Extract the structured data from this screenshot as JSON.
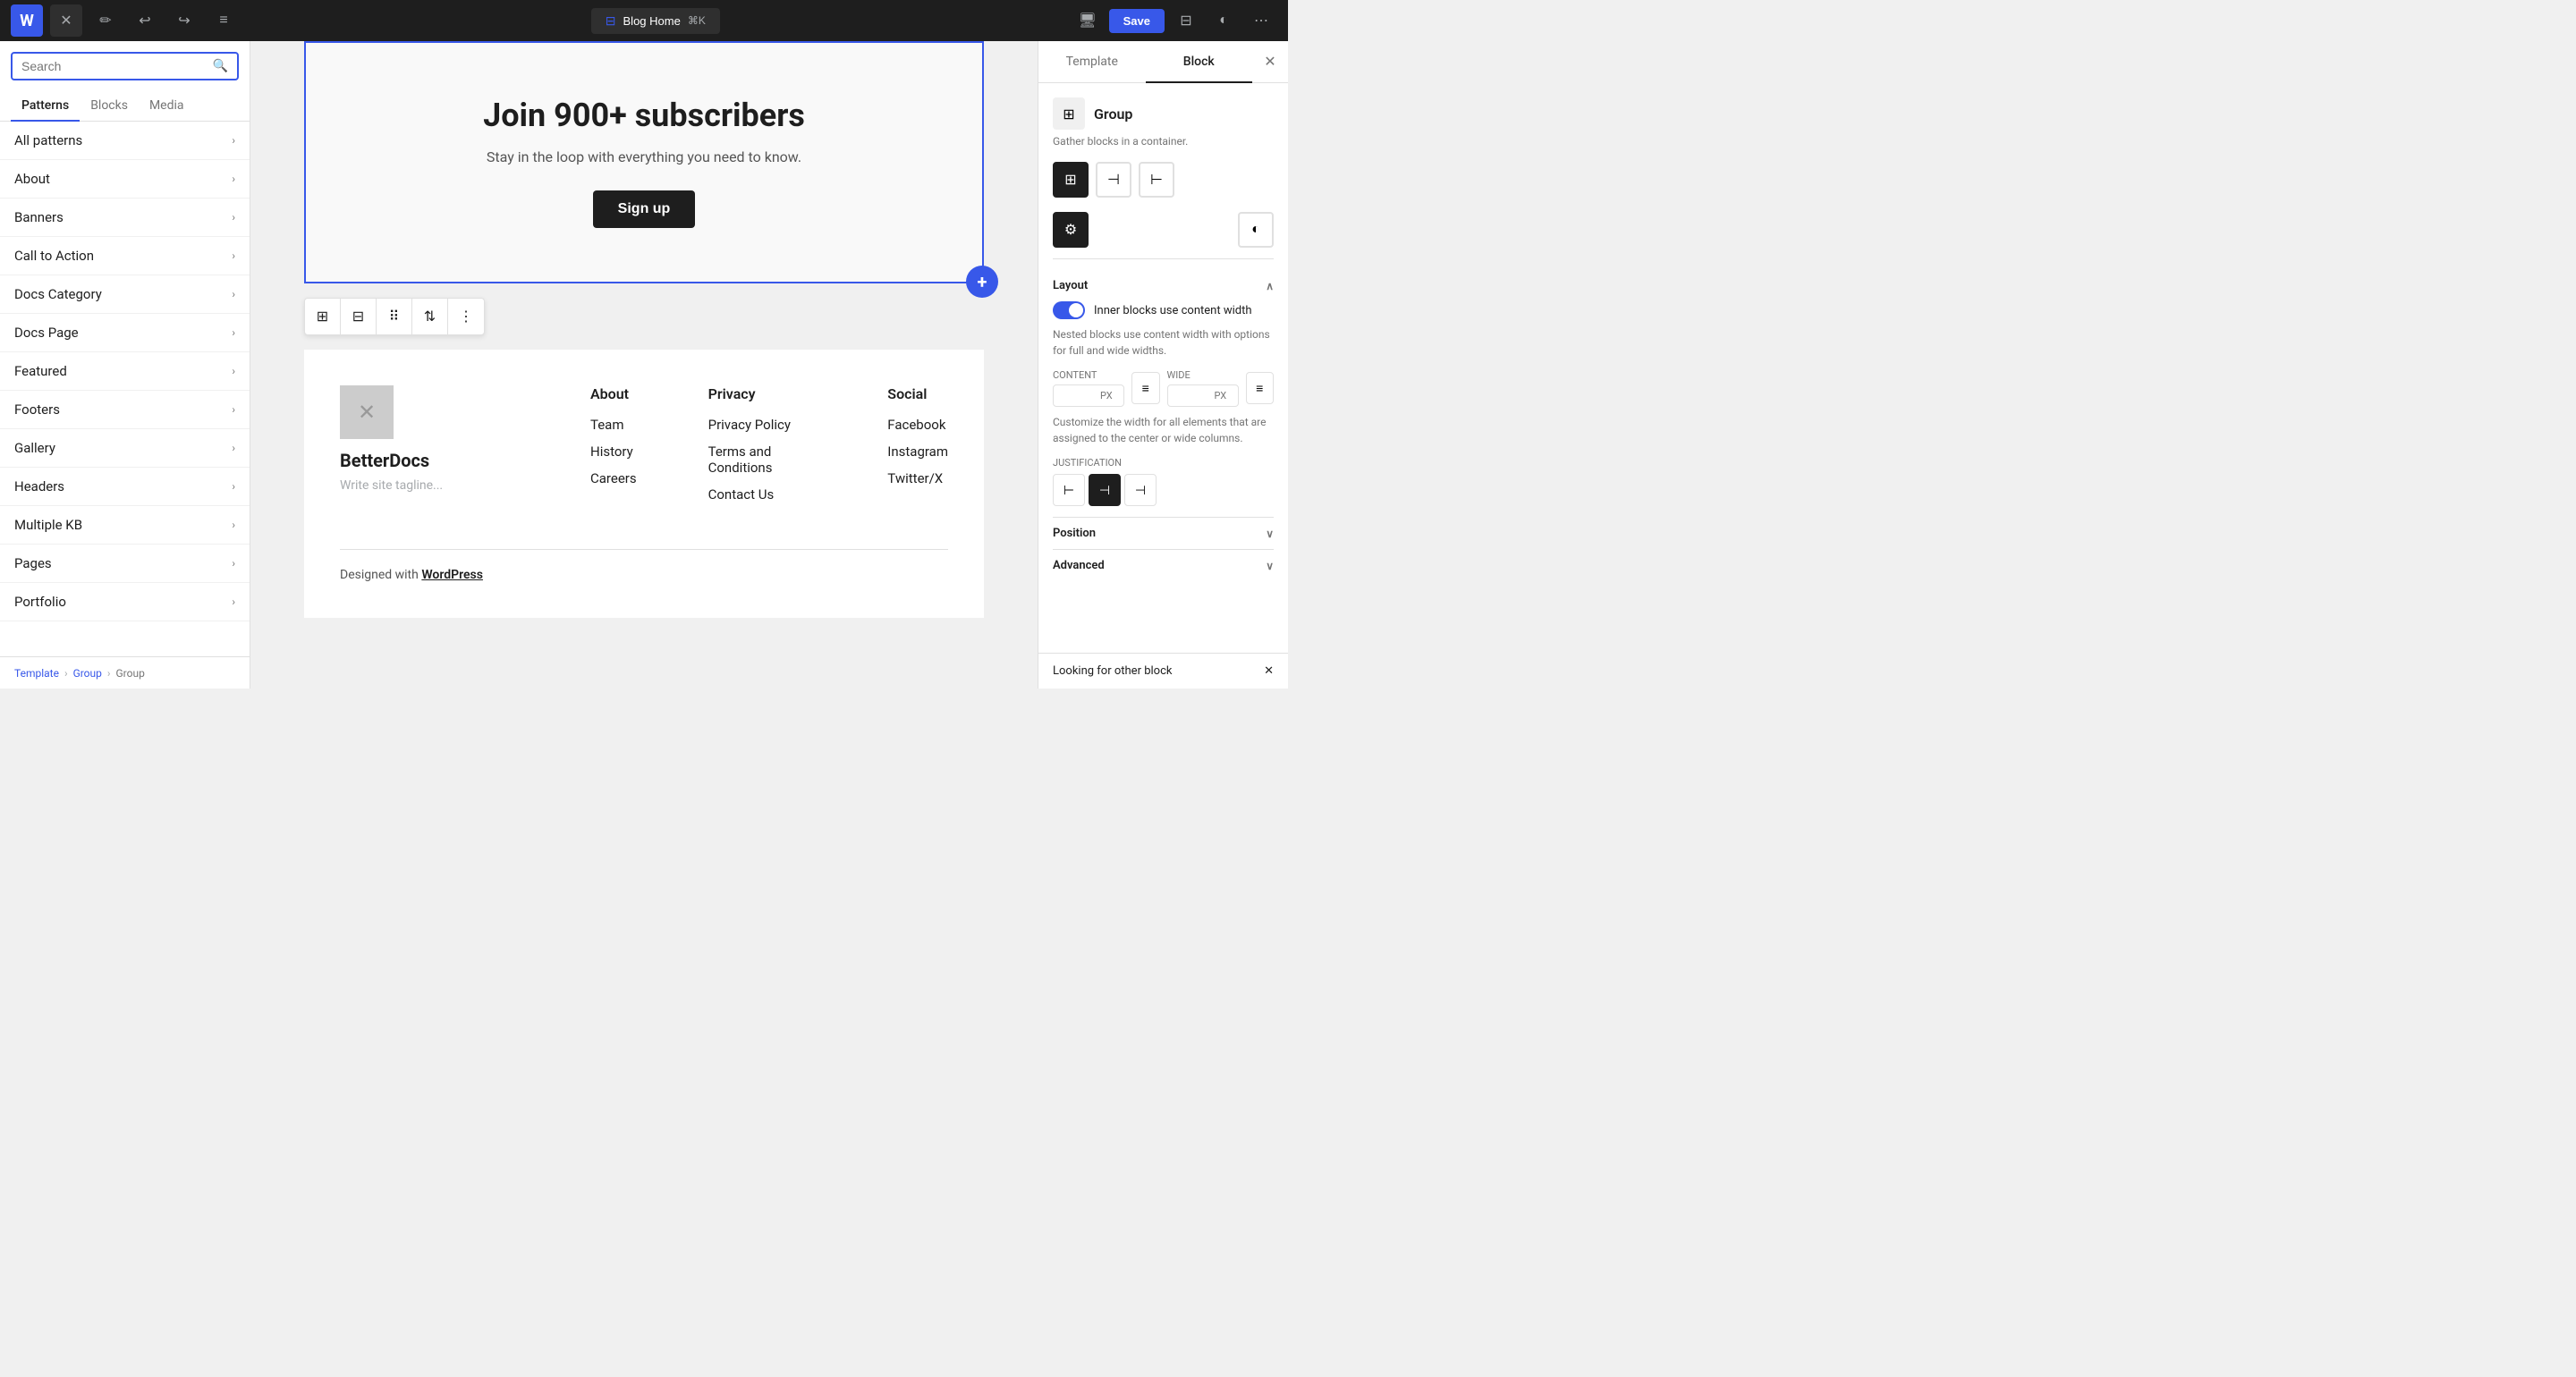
{
  "toolbar": {
    "wp_logo": "W",
    "close_label": "✕",
    "pencil_label": "✏",
    "undo_label": "↩",
    "redo_label": "↪",
    "list_label": "≡",
    "blog_home": "Blog Home",
    "cmd_k": "⌘K",
    "save_label": "Save",
    "desktop_icon": "🖥",
    "sidebar_icon": "⊟",
    "contrast_icon": "◐",
    "more_icon": "⋯"
  },
  "left_sidebar": {
    "search_placeholder": "Search",
    "tabs": [
      "Patterns",
      "Blocks",
      "Media"
    ],
    "active_tab": "Patterns",
    "items": [
      {
        "label": "All patterns"
      },
      {
        "label": "About"
      },
      {
        "label": "Banners"
      },
      {
        "label": "Call to Action"
      },
      {
        "label": "Docs Category"
      },
      {
        "label": "Docs Page"
      },
      {
        "label": "Featured"
      },
      {
        "label": "Footers"
      },
      {
        "label": "Gallery"
      },
      {
        "label": "Headers"
      },
      {
        "label": "Multiple KB"
      },
      {
        "label": "Pages"
      },
      {
        "label": "Portfolio"
      }
    ]
  },
  "breadcrumb": {
    "template": "Template",
    "sep1": "›",
    "group1": "Group",
    "sep2": "›",
    "group2": "Group"
  },
  "canvas": {
    "newsletter": {
      "title": "Join 900+ subscribers",
      "subtitle": "Stay in the loop with everything you need to know.",
      "button_label": "Sign up"
    },
    "footer": {
      "brand_name": "BetterDocs",
      "tagline_placeholder": "Write site tagline...",
      "nav_cols": [
        {
          "heading": "About",
          "links": [
            "Team",
            "History",
            "Careers"
          ]
        },
        {
          "heading": "Privacy",
          "links": [
            "Privacy Policy",
            "Terms and Conditions",
            "Contact Us"
          ]
        },
        {
          "heading": "Social",
          "links": [
            "Facebook",
            "Instagram",
            "Twitter/X"
          ]
        }
      ],
      "footer_text": "Designed with ",
      "footer_link": "WordPress"
    }
  },
  "right_sidebar": {
    "tabs": [
      "Template",
      "Block"
    ],
    "active_tab": "Block",
    "close_icon": "✕",
    "block": {
      "icon": "⊞",
      "name": "Group",
      "description": "Gather blocks in a container.",
      "style_icons": [
        "⊞",
        "⊣",
        "⊢"
      ],
      "settings_icon": "⚙",
      "contrast_icon": "◐"
    },
    "layout": {
      "label": "Layout",
      "toggle_label": "Inner blocks use content width",
      "toggle_desc": "Nested blocks use content width with options for full and wide widths.",
      "content_label": "CONTENT",
      "content_value": "",
      "content_unit": "PX",
      "wide_label": "WIDE",
      "wide_value": "",
      "wide_unit": "PX",
      "customize_desc": "Customize the width for all elements that are assigned to the center or wide columns.",
      "justification_label": "JUSTIFICATION",
      "just_btns": [
        "⊢",
        "⊣",
        "⊣"
      ]
    },
    "position": {
      "label": "Position"
    },
    "advanced": {
      "label": "Advanced"
    },
    "looking_for": "Looking for other block"
  }
}
